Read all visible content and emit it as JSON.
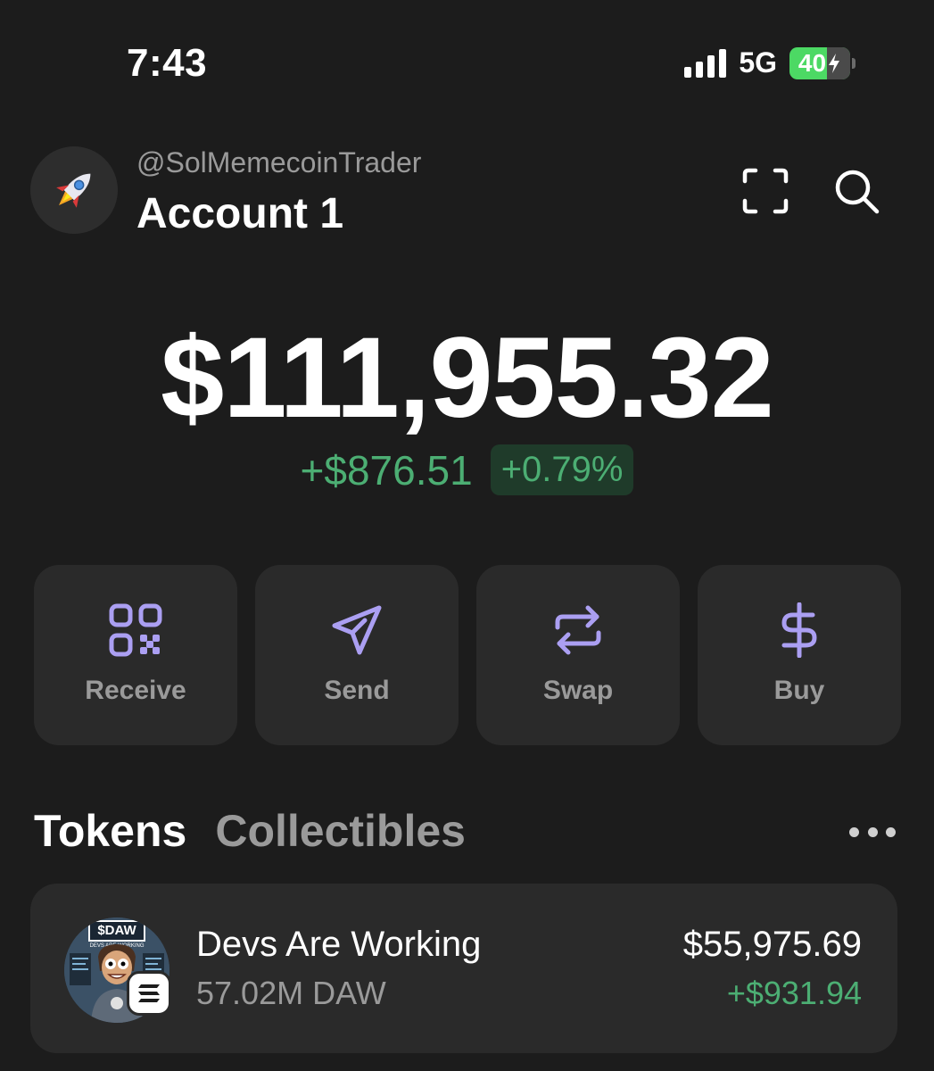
{
  "status_bar": {
    "time": "7:43",
    "network": "5G",
    "battery": "40"
  },
  "header": {
    "handle": "@SolMemecoinTrader",
    "account_name": "Account 1",
    "avatar_icon": "rocket-icon",
    "scan_icon": "scan-icon",
    "search_icon": "search-icon"
  },
  "balance": {
    "total": "$111,955.32",
    "change_amount": "+$876.51",
    "change_percent": "+0.79%"
  },
  "actions": [
    {
      "label": "Receive",
      "icon": "qr-code-icon"
    },
    {
      "label": "Send",
      "icon": "send-icon"
    },
    {
      "label": "Swap",
      "icon": "swap-icon"
    },
    {
      "label": "Buy",
      "icon": "dollar-icon"
    }
  ],
  "tabs": {
    "tokens": "Tokens",
    "collectibles": "Collectibles",
    "more_icon": "more-icon"
  },
  "tokens": [
    {
      "name": "Devs Are Working",
      "amount": "57.02M DAW",
      "value": "$55,975.69",
      "change": "+$931.94",
      "image_caption": "$DAW",
      "image_subcaption": "DEVS ARE WORKING",
      "chain_icon": "solana-icon"
    }
  ],
  "colors": {
    "background": "#1c1c1c",
    "card": "#2a2a2a",
    "accent_purple": "#ab9ff2",
    "positive_green": "#4cae73",
    "positive_bg": "#1f3b2a",
    "muted_text": "#9a9a9a"
  }
}
